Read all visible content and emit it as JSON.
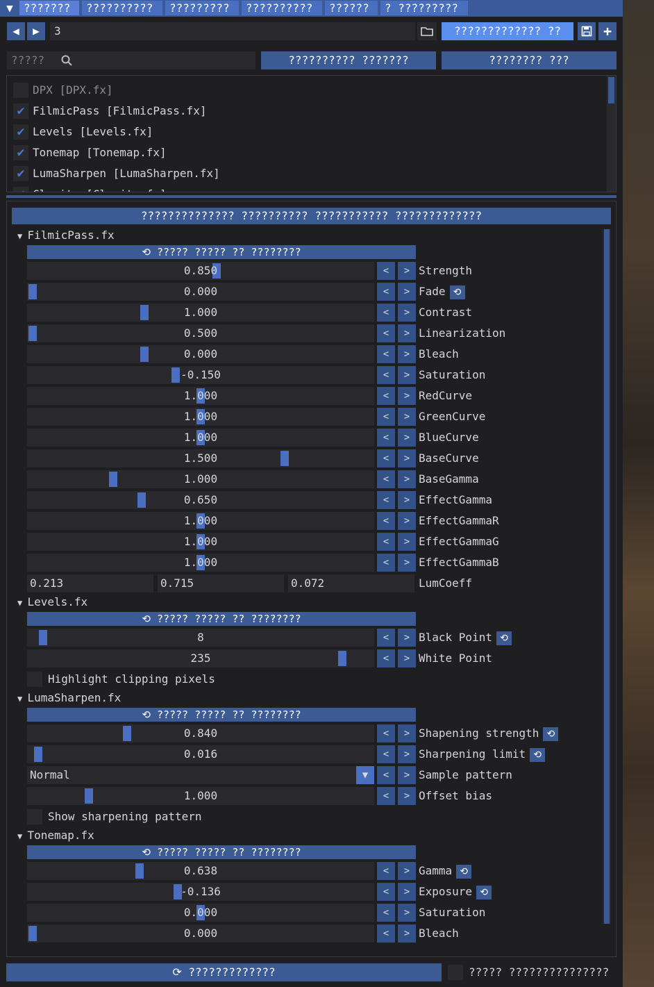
{
  "tabs": [
    "???????",
    "??????????",
    "?????????",
    "??????????",
    "??????",
    "? ?????????"
  ],
  "toolbar": {
    "preset_value": "3",
    "preset_name_button": "????????????? ??"
  },
  "search": {
    "placeholder": "?????"
  },
  "actions": {
    "left": "?????????? ???????",
    "right": "???????? ???"
  },
  "effects_list": [
    {
      "label": "DPX [DPX.fx]",
      "checked": false
    },
    {
      "label": "FilmicPass [FilmicPass.fx]",
      "checked": true
    },
    {
      "label": "Levels [Levels.fx]",
      "checked": true
    },
    {
      "label": "Tonemap [Tonemap.fx]",
      "checked": true
    },
    {
      "label": "LumaSharpen [LumaSharpen.fx]",
      "checked": true
    },
    {
      "label": "Clarity [Clarity.fx]",
      "checked": true
    }
  ],
  "main_header": "?????????????? ?????????? ??????????? ?????????????",
  "reset_label": "????? ????? ?? ????????",
  "filmic": {
    "title": "FilmicPass.fx",
    "params": [
      {
        "name": "Strength",
        "value": "0.850",
        "level": 0.547,
        "reset": false
      },
      {
        "name": "Fade",
        "value": "0.000",
        "level": 0.0,
        "reset": true
      },
      {
        "name": "Contrast",
        "value": "1.000",
        "level": 0.333,
        "reset": false
      },
      {
        "name": "Linearization",
        "value": "0.500",
        "level": 0.0,
        "reset": false
      },
      {
        "name": "Bleach",
        "value": "0.000",
        "level": 0.333,
        "reset": false
      },
      {
        "name": "Saturation",
        "value": "-0.150",
        "level": 0.425,
        "reset": false
      },
      {
        "name": "RedCurve",
        "value": "1.000",
        "level": 0.5,
        "reset": false
      },
      {
        "name": "GreenCurve",
        "value": "1.000",
        "level": 0.5,
        "reset": false
      },
      {
        "name": "BlueCurve",
        "value": "1.000",
        "level": 0.5,
        "reset": false
      },
      {
        "name": "BaseCurve",
        "value": "1.500",
        "level": 0.75,
        "reset": false
      },
      {
        "name": "BaseGamma",
        "value": "1.000",
        "level": 0.24,
        "reset": false
      },
      {
        "name": "EffectGamma",
        "value": "0.650",
        "level": 0.325,
        "reset": false
      },
      {
        "name": "EffectGammaR",
        "value": "1.000",
        "level": 0.5,
        "reset": false
      },
      {
        "name": "EffectGammaG",
        "value": "1.000",
        "level": 0.5,
        "reset": false
      },
      {
        "name": "EffectGammaB",
        "value": "1.000",
        "level": 0.5,
        "reset": false
      }
    ],
    "lumcoeff": {
      "name": "LumCoeff",
      "values": [
        "0.213",
        "0.715",
        "0.072"
      ]
    }
  },
  "levels": {
    "title": "Levels.fx",
    "params": [
      {
        "name": "Black Point",
        "value": "8",
        "level": 0.031,
        "reset": true
      },
      {
        "name": "White Point",
        "value": "235",
        "level": 0.922,
        "reset": false
      }
    ],
    "checkbox": "Highlight clipping pixels"
  },
  "lumasharpen": {
    "title": "LumaSharpen.fx",
    "params": [
      {
        "name": "Shapening strength",
        "value": "0.840",
        "level": 0.28,
        "reset": true
      },
      {
        "name": "Sharpening limit",
        "value": "0.016",
        "level": 0.016,
        "reset": true
      }
    ],
    "combo": {
      "name": "Sample pattern",
      "value": "Normal"
    },
    "offset": {
      "name": "Offset bias",
      "value": "1.000",
      "level": 0.167
    },
    "checkbox": "Show sharpening pattern"
  },
  "tonemap": {
    "title": "Tonemap.fx",
    "params": [
      {
        "name": "Gamma",
        "value": "0.638",
        "level": 0.319,
        "reset": true
      },
      {
        "name": "Exposure",
        "value": "-0.136",
        "level": 0.432,
        "reset": true
      },
      {
        "name": "Saturation",
        "value": "0.000",
        "level": 0.5,
        "reset": false
      },
      {
        "name": "Bleach",
        "value": "0.000",
        "level": 0.0,
        "reset": false
      }
    ]
  },
  "footer": {
    "reload": "?????????????",
    "right_label": "????? ???????????????"
  }
}
